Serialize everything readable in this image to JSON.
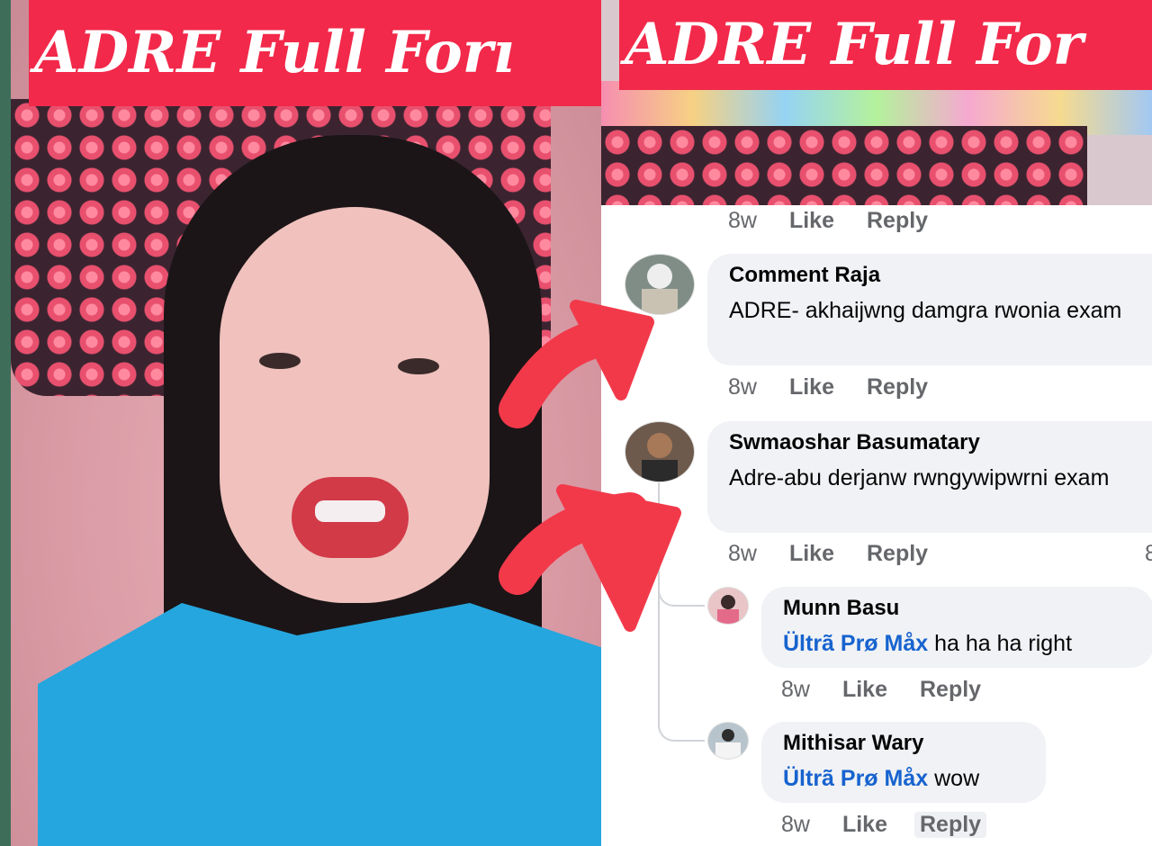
{
  "banner": {
    "left_text": "ADRE Full Forı",
    "right_text": "ADRE Full For"
  },
  "colors": {
    "banner_red": "#f2294a",
    "arrow_red": "#f2394a",
    "mention_blue": "#1763cf",
    "meta_gray": "#65676b"
  },
  "top_meta": {
    "time": "8w",
    "like": "Like",
    "reply": "Reply"
  },
  "comments": [
    {
      "name": "Comment Raja",
      "text": "ADRE- akhaijwng damgra rwonia exam",
      "time": "8w",
      "like": "Like",
      "reply": "Reply"
    },
    {
      "name": "Swmaoshar Basumatary",
      "text": "Adre-abu derjanw rwngywipwrni exam",
      "time": "8w",
      "like": "Like",
      "reply": "Reply",
      "edge_fragment": "8"
    }
  ],
  "replies": [
    {
      "name": "Munn Basu",
      "mention": "Ültrã Prø Måx",
      "text": "ha ha ha right",
      "time": "8w",
      "like": "Like",
      "reply": "Reply"
    },
    {
      "name": "Mithisar Wary",
      "mention": "Ültrã Prø Måx",
      "text": "wow",
      "time": "8w",
      "like": "Like",
      "reply": "Reply"
    }
  ]
}
